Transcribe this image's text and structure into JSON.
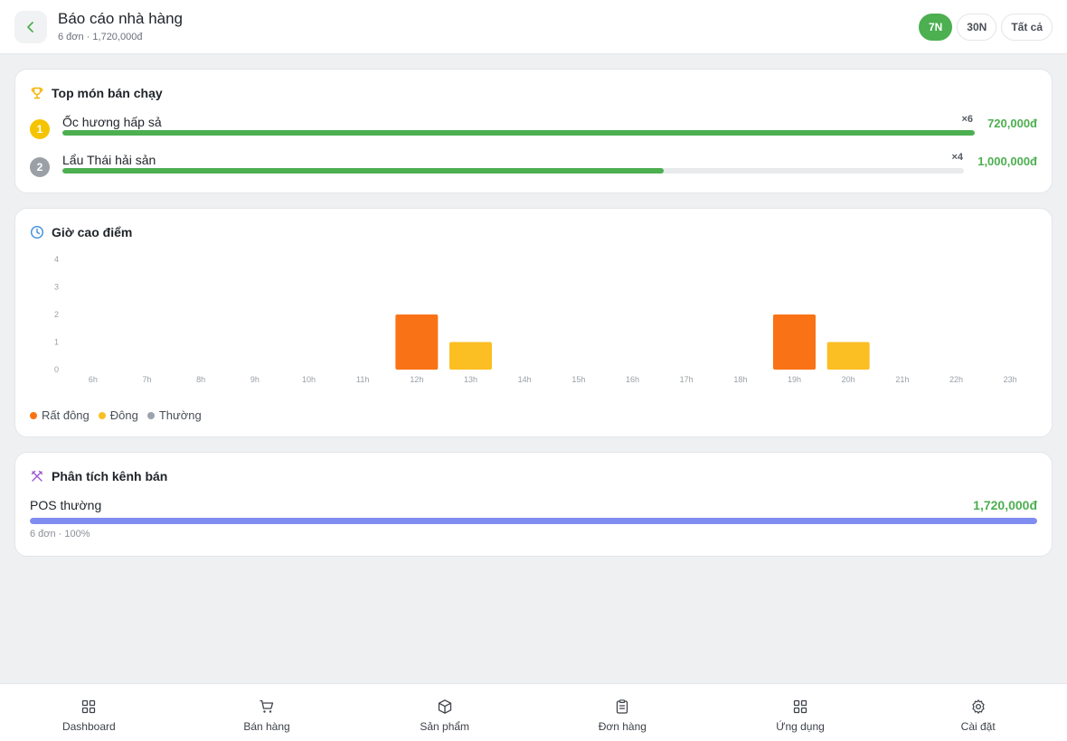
{
  "header": {
    "title": "Báo cáo nhà hàng",
    "subtitle": "6 đơn · 1,720,000đ",
    "periods": [
      {
        "label": "7N",
        "active": true
      },
      {
        "label": "30N",
        "active": false
      },
      {
        "label": "Tất cả",
        "active": false
      }
    ]
  },
  "top_dishes": {
    "title": "Top món bán chạy",
    "title_icon": "trophy-icon",
    "items": [
      {
        "rank": "1",
        "name": "Ốc hương hấp sả",
        "qty": "×6",
        "amount": "720,000đ",
        "progress": 1.0,
        "rank_color": "#f5c400"
      },
      {
        "rank": "2",
        "name": "Lẩu Thái hải sản",
        "qty": "×4",
        "amount": "1,000,000đ",
        "progress": 0.667,
        "rank_color": "#9aa0a6"
      }
    ]
  },
  "peak_hours": {
    "title": "Giờ cao điểm",
    "title_icon": "clock-icon",
    "legend": [
      {
        "label": "Rất đông",
        "color": "#f97316"
      },
      {
        "label": "Đông",
        "color": "#fbbf24"
      },
      {
        "label": "Thường",
        "color": "#9ca3af"
      }
    ]
  },
  "chart_data": {
    "type": "bar",
    "title": "",
    "xlabel": "",
    "ylabel": "",
    "categories": [
      "6h",
      "7h",
      "8h",
      "9h",
      "10h",
      "11h",
      "12h",
      "13h",
      "14h",
      "15h",
      "16h",
      "17h",
      "18h",
      "19h",
      "20h",
      "21h",
      "22h",
      "23h"
    ],
    "values": [
      0,
      0,
      0,
      0,
      0,
      0,
      2,
      1,
      0,
      0,
      0,
      0,
      0,
      2,
      1,
      0,
      0,
      0
    ],
    "bar_colors": [
      "#9ca3af",
      "#9ca3af",
      "#9ca3af",
      "#9ca3af",
      "#9ca3af",
      "#9ca3af",
      "#f97316",
      "#fbbf24",
      "#9ca3af",
      "#9ca3af",
      "#9ca3af",
      "#9ca3af",
      "#9ca3af",
      "#f97316",
      "#fbbf24",
      "#9ca3af",
      "#9ca3af",
      "#9ca3af"
    ],
    "yticks": [
      0,
      1,
      2,
      3,
      4
    ],
    "ylim": [
      0,
      4
    ],
    "grid": false,
    "legend_position": "bottom-left"
  },
  "channels": {
    "title": "Phân tích kênh bán",
    "title_icon": "utensils-icon",
    "items": [
      {
        "name": "POS thường",
        "amount": "1,720,000đ",
        "meta": "6 đơn · 100%",
        "progress": 1.0
      }
    ]
  },
  "nav": [
    {
      "label": "Dashboard",
      "icon": "dashboard-icon"
    },
    {
      "label": "Bán hàng",
      "icon": "cart-icon"
    },
    {
      "label": "Sản phẩm",
      "icon": "box-icon"
    },
    {
      "label": "Đơn hàng",
      "icon": "clipboard-icon"
    },
    {
      "label": "Ứng dụng",
      "icon": "apps-icon"
    },
    {
      "label": "Cài đặt",
      "icon": "settings-icon"
    }
  ]
}
